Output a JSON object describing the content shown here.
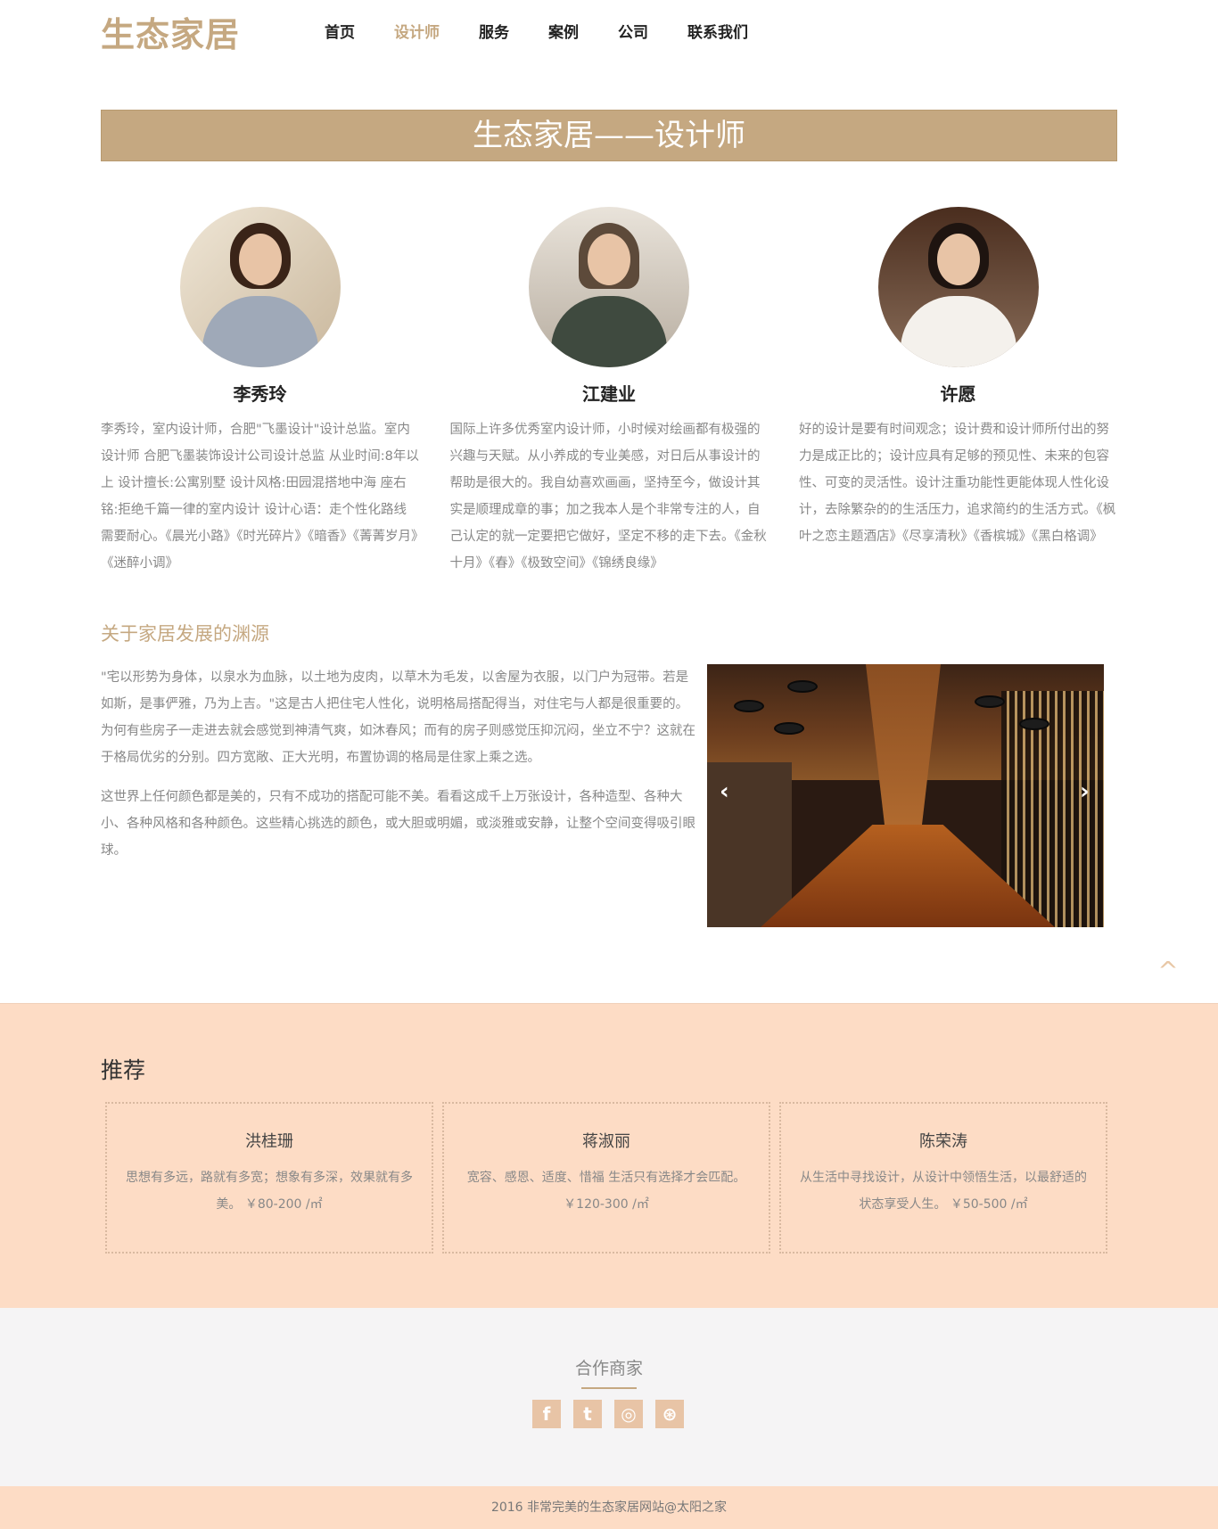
{
  "header": {
    "logo": "生态家居",
    "nav": [
      "首页",
      "设计师",
      "服务",
      "案例",
      "公司",
      "联系我们"
    ],
    "active": "设计师"
  },
  "banner": {
    "title": "生态家居——设计师"
  },
  "designers": [
    {
      "name": "李秀玲",
      "desc": "李秀玲，室内设计师，合肥\"飞墨设计\"设计总监。室内设计师 合肥飞墨装饰设计公司设计总监 从业时间:8年以上 设计擅长:公寓别墅 设计风格:田园混搭地中海 座右铭:拒绝千篇一律的室内设计 设计心语：走个性化路线需要耐心。《晨光小路》《时光碎片》《暗香》《菁菁岁月》《迷醉小调》"
    },
    {
      "name": "江建业",
      "desc": "国际上许多优秀室内设计师，小时候对绘画都有极强的兴趣与天赋。从小养成的专业美感，对日后从事设计的帮助是很大的。我自幼喜欢画画，坚持至今，做设计其实是顺理成章的事；加之我本人是个非常专注的人，自己认定的就一定要把它做好，坚定不移的走下去。《金秋十月》《春》《极致空间》《锦绣良缘》"
    },
    {
      "name": "许愿",
      "desc": "好的设计是要有时间观念；设计费和设计师所付出的努力是成正比的；设计应具有足够的预见性、未来的包容性、可变的灵活性。设计注重功能性更能体现人性化设计，去除繁杂的的生活压力，追求简约的生活方式。《枫叶之恋主题酒店》《尽享清秋》《香槟城》《黑白格调》"
    }
  ],
  "about": {
    "title": "关于家居发展的渊源",
    "paragraphs": [
      "\"宅以形势为身体，以泉水为血脉，以土地为皮肉，以草木为毛发，以舍屋为衣服，以门户为冠带。若是如斯，是事俨雅，乃为上吉。\"这是古人把住宅人性化，说明格局搭配得当，对住宅与人都是很重要的。为何有些房子一走进去就会感觉到神清气爽，如沐春风；而有的房子则感觉压抑沉闷，坐立不宁？这就在于格局优劣的分别。四方宽敞、正大光明，布置协调的格局是住家上乘之选。",
      "这世界上任何颜色都是美的，只有不成功的搭配可能不美。看看这成千上万张设计，各种造型、各种大小、各种风格和各种颜色。这些精心挑选的颜色，或大胆或明媚，或淡雅或安静，让整个空间变得吸引眼球。"
    ]
  },
  "slider": {
    "prev": "‹",
    "next": "›"
  },
  "totop": "^",
  "recommend": {
    "title": "推荐",
    "cards": [
      {
        "name": "洪桂珊",
        "desc": "思想有多远，路就有多宽；想象有多深，效果就有多美。 ￥80-200 /㎡"
      },
      {
        "name": "蒋淑丽",
        "desc": "宽容、感恩、适度、惜福 生活只有选择才会匹配。 ￥120-300 /㎡"
      },
      {
        "name": "陈荣涛",
        "desc": "从生活中寻找设计，从设计中领悟生活，以最舒适的状态享受人生。 ￥50-500 /㎡"
      }
    ]
  },
  "partners": {
    "title": "合作商家",
    "icons": [
      "facebook-icon",
      "twitter-icon",
      "instagram-icon",
      "dribbble-icon"
    ],
    "glyphs": [
      "f",
      "t",
      "◎",
      "⊛"
    ]
  },
  "footer": {
    "text": "2016 非常完美的生态家居网站@太阳之家"
  }
}
